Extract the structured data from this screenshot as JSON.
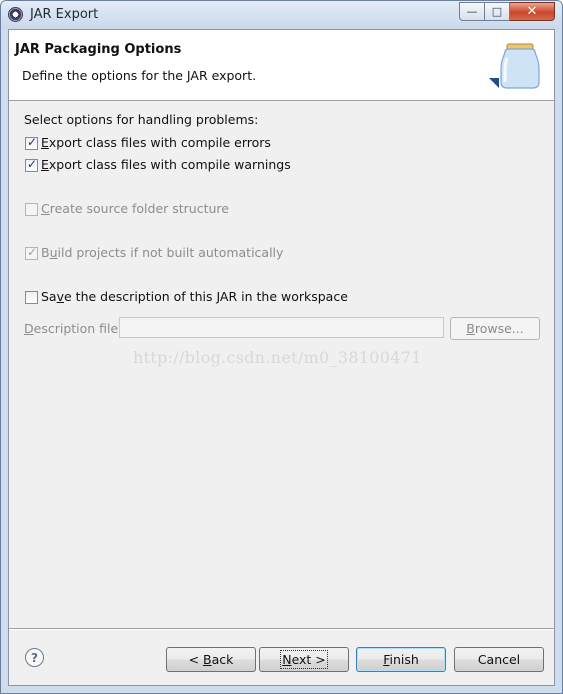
{
  "window": {
    "title": "JAR Export",
    "icon": "eclipse-icon",
    "controls": {
      "minimize": "—",
      "maximize": "□",
      "close": "✕"
    }
  },
  "header": {
    "title": "JAR Packaging Options",
    "description": "Define the options for the JAR export.",
    "icon": "jar-icon"
  },
  "options": {
    "problems_label": "Select options for handling problems:",
    "export_errors": {
      "label_mnemonic": "E",
      "label_rest": "xport class files with compile errors",
      "checked": true,
      "enabled": true
    },
    "export_warnings": {
      "label_mnemonic": "E",
      "label_rest": "xport class files with compile warnings",
      "checked": true,
      "enabled": true
    },
    "create_source_folder": {
      "label_mnemonic": "C",
      "label_rest": "reate source folder structure",
      "checked": false,
      "enabled": false
    },
    "build_projects": {
      "label_pre": "B",
      "label_mnemonic": "u",
      "label_rest": "ild projects if not built automatically",
      "checked": true,
      "enabled": false
    },
    "save_description": {
      "label_pre": "Sa",
      "label_mnemonic": "v",
      "label_rest": "e the description of this JAR in the workspace",
      "checked": false,
      "enabled": true
    }
  },
  "description_file": {
    "label_mnemonic": "D",
    "label_rest": "escription file:",
    "value": "",
    "browse_label_mnemonic": "B",
    "browse_label_rest": "rowse..."
  },
  "watermark": "http://blog.csdn.net/m0_38100471",
  "buttons": {
    "help": "?",
    "back": {
      "pre": "< ",
      "mnemonic": "B",
      "rest": "ack"
    },
    "next": {
      "mnemonic": "N",
      "rest": "ext >"
    },
    "finish": {
      "mnemonic": "F",
      "rest": "inish"
    },
    "cancel": "Cancel"
  },
  "colors": {
    "accent": "#3c7fb1",
    "titlebar": "#cad8ea",
    "close": "#c9472c"
  }
}
